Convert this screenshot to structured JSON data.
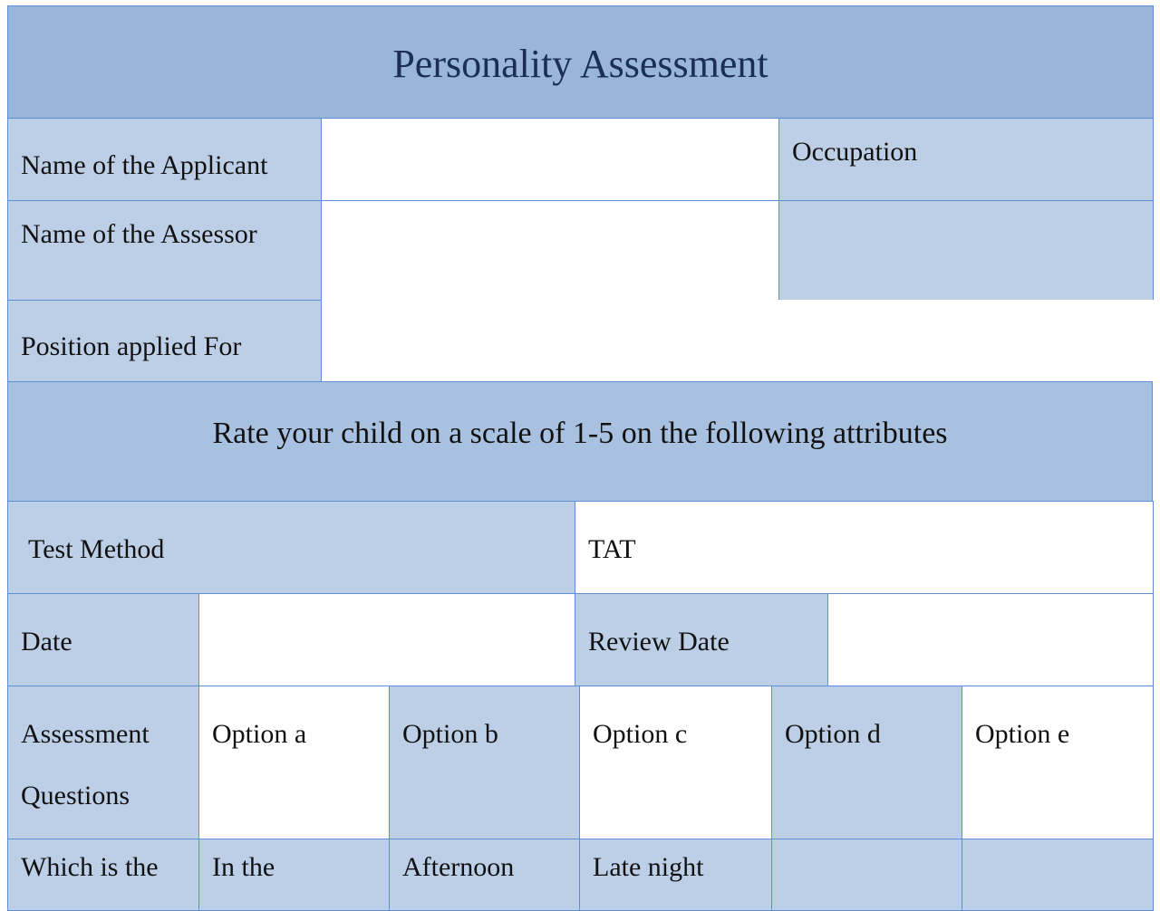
{
  "form": {
    "title": "Personality Assessment",
    "fields": {
      "applicant_label": "Name of the Applicant",
      "applicant_value": "",
      "occupation_label": "Occupation",
      "occupation_value": "",
      "assessor_label": "Name of the Assessor",
      "assessor_value": "",
      "position_label": "Position applied For",
      "position_value": ""
    },
    "section_title": "Rate your child on a scale of 1-5 on the following attributes",
    "test_method_label": "Test Method",
    "test_method_value": "TAT",
    "date_label": "Date",
    "date_value": "",
    "review_date_label": "Review Date",
    "review_date_value": "",
    "questions_header": {
      "label_line1": "Assessment",
      "label_line2": "Questions",
      "options": [
        "Option a",
        "Option b",
        "Option c",
        "Option d",
        "Option e"
      ]
    },
    "question_rows": [
      {
        "question": "Which is the",
        "answers": [
          "In the",
          "Afternoon",
          "Late night",
          "",
          ""
        ]
      }
    ]
  },
  "colors": {
    "header_bg": "#99b6da",
    "label_bg": "#bccfe7",
    "section_bg": "#a9c1e0",
    "border": "#5b8fd6",
    "title_text": "#1b2e57"
  }
}
